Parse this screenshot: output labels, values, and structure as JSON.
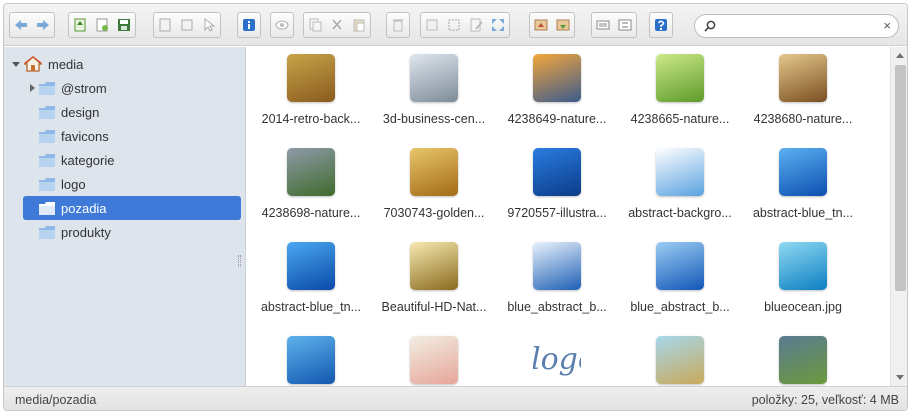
{
  "toolbar": {
    "groups": [
      {
        "buttons": [
          "back-icon",
          "forward-icon"
        ]
      },
      {
        "buttons": [
          "upload-icon",
          "new-file-icon",
          "save-icon"
        ]
      },
      {
        "buttons": [
          "open-icon",
          "download-icon",
          "select-icon"
        ]
      },
      {
        "buttons": [
          "info-icon"
        ]
      },
      {
        "buttons": [
          "preview-icon"
        ]
      },
      {
        "buttons": [
          "copy-icon",
          "cut-icon",
          "paste-icon"
        ]
      },
      {
        "buttons": [
          "delete-icon"
        ]
      },
      {
        "buttons": [
          "duplicate-icon",
          "rename-icon",
          "edit-icon",
          "resize-icon"
        ]
      },
      {
        "buttons": [
          "extract-icon",
          "archive-icon"
        ]
      },
      {
        "buttons": [
          "view-icons-icon",
          "sort-icon"
        ]
      },
      {
        "buttons": [
          "help-icon"
        ]
      }
    ],
    "search": {
      "value": "",
      "placeholder": "",
      "clear_label": "×"
    }
  },
  "tree": {
    "root": "media",
    "items": [
      {
        "label": "@strom",
        "expandable": true
      },
      {
        "label": "design"
      },
      {
        "label": "favicons"
      },
      {
        "label": "kategorie"
      },
      {
        "label": "logo"
      },
      {
        "label": "pozadia",
        "selected": true
      },
      {
        "label": "produkty"
      }
    ]
  },
  "files": [
    {
      "name": "2014-retro-back...",
      "colors": [
        "#c7a449",
        "#8a5b1e"
      ]
    },
    {
      "name": "3d-business-cen...",
      "colors": [
        "#dfe6ee",
        "#7d8b98"
      ]
    },
    {
      "name": "4238649-nature...",
      "colors": [
        "#f3a63c",
        "#3c5b8c"
      ]
    },
    {
      "name": "4238665-nature...",
      "colors": [
        "#cde98a",
        "#5d9a2a"
      ]
    },
    {
      "name": "4238680-nature...",
      "colors": [
        "#e5c88c",
        "#7a4f22"
      ]
    },
    {
      "name": "4238698-nature...",
      "colors": [
        "#8f9aa8",
        "#3f6b2c"
      ]
    },
    {
      "name": "7030743-golden...",
      "colors": [
        "#e8c66a",
        "#a36a16"
      ]
    },
    {
      "name": "9720557-illustra...",
      "colors": [
        "#2a7de1",
        "#0b3b88"
      ]
    },
    {
      "name": "abstract-backgro...",
      "colors": [
        "#ffffff",
        "#5aa2e0"
      ]
    },
    {
      "name": "abstract-blue_tn...",
      "colors": [
        "#5bb0f2",
        "#0d4fb0"
      ]
    },
    {
      "name": "abstract-blue_tn...",
      "colors": [
        "#4aa8f0",
        "#0a49a8"
      ]
    },
    {
      "name": "Beautiful-HD-Nat...",
      "colors": [
        "#f6e9b0",
        "#8a6a1e"
      ]
    },
    {
      "name": "blue_abstract_b...",
      "colors": [
        "#e9f3fb",
        "#1e5fb5"
      ]
    },
    {
      "name": "blue_abstract_b...",
      "colors": [
        "#9ccdf3",
        "#1257b8"
      ]
    },
    {
      "name": "blueocean.jpg",
      "colors": [
        "#8fd9f2",
        "#0c7fc2"
      ]
    },
    {
      "name": "",
      "colors": [
        "#5fb2ec",
        "#1257b0"
      ]
    },
    {
      "name": "",
      "colors": [
        "#f2eee2",
        "#e6a59a"
      ]
    },
    {
      "name": "",
      "colors": [
        "#ffffff",
        "#ffffff"
      ],
      "logo_text": "logo"
    },
    {
      "name": "",
      "colors": [
        "#a6d8ec",
        "#c9a95a"
      ]
    },
    {
      "name": "",
      "colors": [
        "#5a7a92",
        "#6b9a3c"
      ]
    }
  ],
  "status": {
    "path": "media/pozadia",
    "info": "položky: 25, veľkosť: 4 MB"
  },
  "colors": {
    "sidebar_bg": "#dde4ec",
    "selected_bg": "#3f7ad8",
    "folder": "#8fb8e6",
    "icon_blue": "#2a6fc9"
  }
}
